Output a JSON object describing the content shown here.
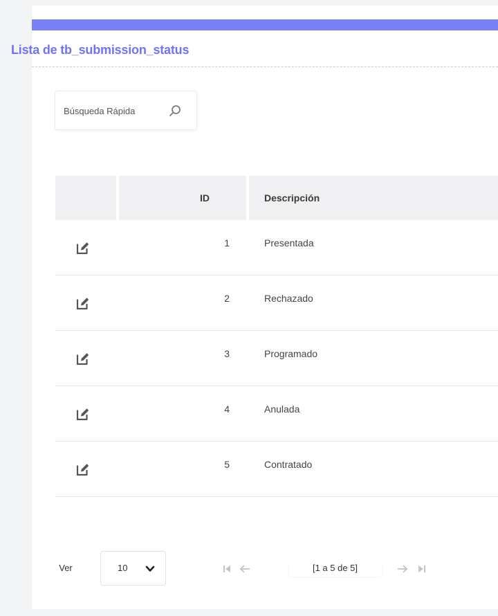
{
  "header": {
    "title": "Lista de tb_submission_status",
    "accent_color": "#7b80f2"
  },
  "search": {
    "placeholder": "Búsqueda Rápida",
    "icon": "search-icon"
  },
  "table": {
    "columns": [
      "",
      "ID",
      "Descripción"
    ],
    "rows": [
      {
        "id": "1",
        "descripcion": "Presentada"
      },
      {
        "id": "2",
        "descripcion": "Rechazado"
      },
      {
        "id": "3",
        "descripcion": "Programado"
      },
      {
        "id": "4",
        "descripcion": "Anulada"
      },
      {
        "id": "5",
        "descripcion": "Contratado"
      }
    ],
    "row_action_icon": "edit-icon"
  },
  "pagination": {
    "ver_label": "Ver",
    "page_size": "10",
    "info": "[1 a 5 de 5]",
    "icons": [
      "first-page-icon",
      "prev-page-icon",
      "next-page-icon",
      "last-page-icon"
    ]
  }
}
